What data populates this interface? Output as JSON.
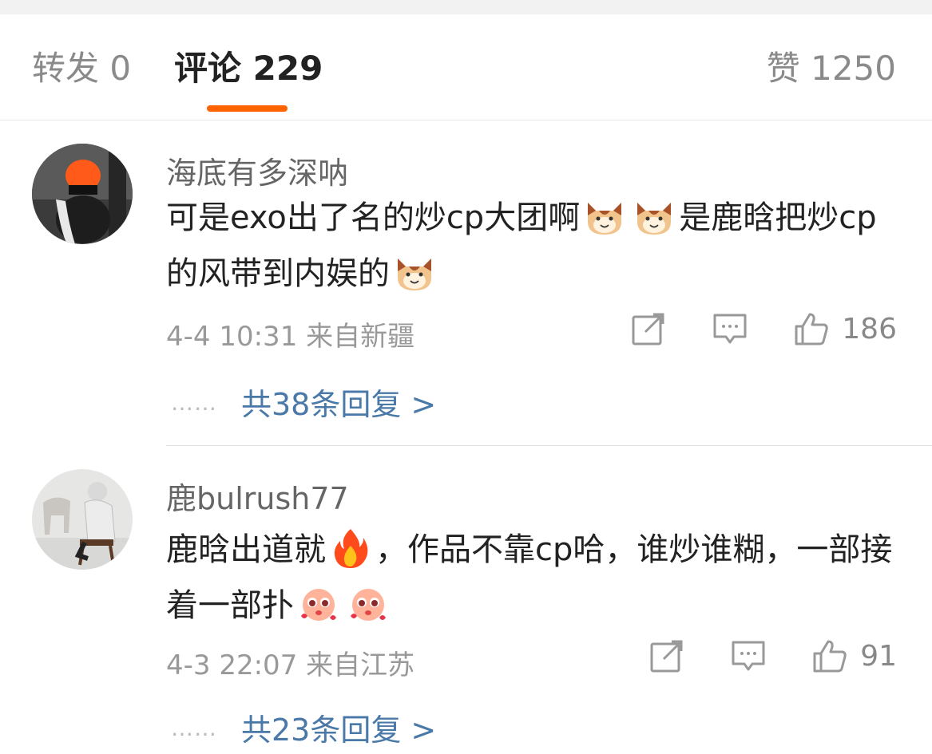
{
  "tabs": {
    "repost": "转发 0",
    "comments": "评论 229",
    "likes": "赞 1250"
  },
  "colors": {
    "accent": "#ff6200",
    "link": "#4a79a8"
  },
  "comments": [
    {
      "user": "海底有多深呐",
      "text_a": "可是exo出了名的炒cp大团啊",
      "text_b": "是鹿晗把炒cp的风带到内娱的",
      "emojis": [
        "cat-face-emoji",
        "cat-face-emoji",
        "cat-face-emoji"
      ],
      "time": "4-4 10:31",
      "location": "来自新疆",
      "likes": "186",
      "dots": "……",
      "replies": "共38条回复 >"
    },
    {
      "user": "鹿bulrush77",
      "text_a": "鹿晗出道就",
      "text_b": "，作品不靠cp哈，谁炒谁糊，一部接着一部扑",
      "emojis": [
        "fire-emoji",
        "pleading-face-emoji",
        "pleading-face-emoji"
      ],
      "time": "4-3 22:07",
      "location": "来自江苏",
      "likes": "91",
      "dots": "……",
      "replies": "共23条回复 >"
    }
  ]
}
